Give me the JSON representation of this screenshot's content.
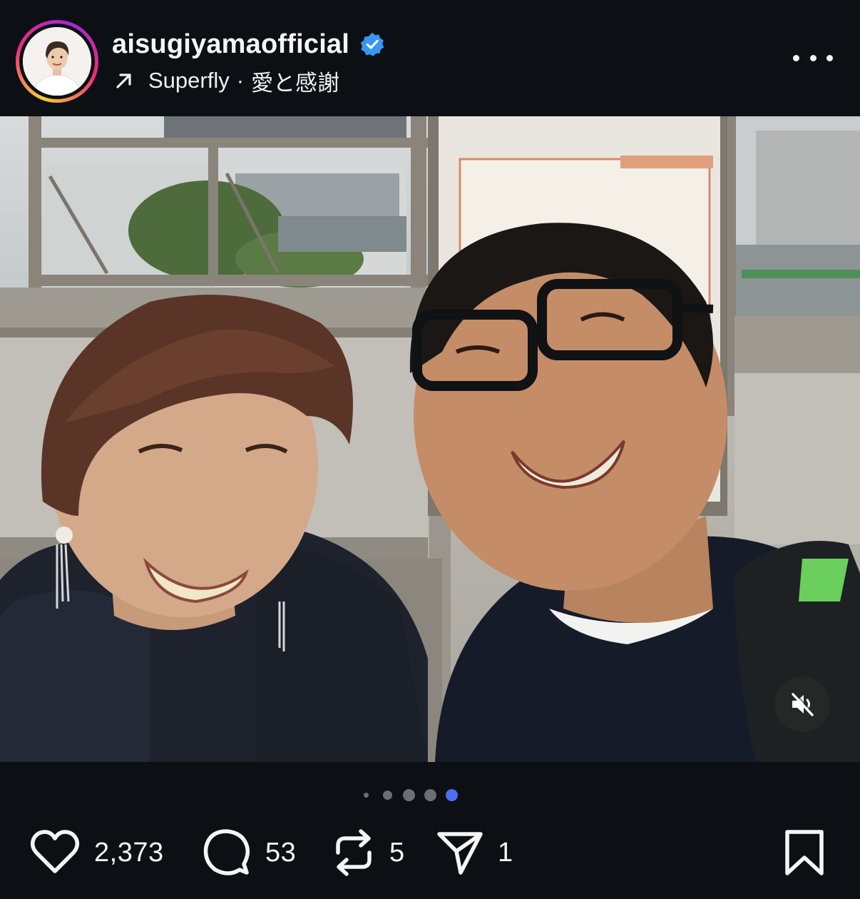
{
  "post": {
    "username": "aisugiyamaofficial",
    "verified": true,
    "music": {
      "artist": "Superfly",
      "separator": "·",
      "song": "愛と感謝"
    }
  },
  "carousel": {
    "total": 5,
    "active_index": 4
  },
  "actions": {
    "like_count": "2,373",
    "comment_count": "53",
    "repost_count": "5",
    "share_count": "1"
  },
  "icons": {
    "verified": "verified-badge-icon",
    "music": "arrow-up-right-icon",
    "more": "more-horizontal-icon",
    "mute": "speaker-muted-icon",
    "like": "heart-icon",
    "comment": "comment-bubble-icon",
    "repost": "repost-icon",
    "share": "paper-plane-icon",
    "save": "bookmark-icon"
  },
  "colors": {
    "background": "#0c1014",
    "verified": "#3897f0",
    "active_dot": "#4f6cf5"
  }
}
